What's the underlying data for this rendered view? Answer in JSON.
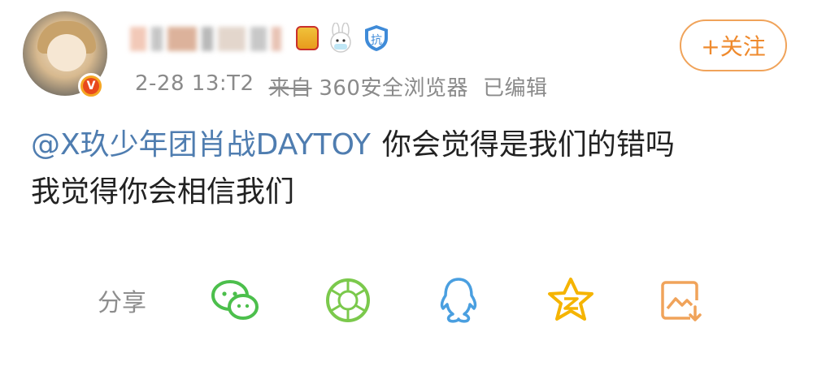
{
  "post": {
    "author_name": "██████",
    "meta": {
      "time": "2-28 13:T2",
      "source_prefix": "来自",
      "source": "360安全浏览器",
      "edited": "已编辑"
    },
    "follow_label": "+关注",
    "mention": "@X玖少年团肖战DAYTOY",
    "text_line1": "你会觉得是我们的错吗",
    "text_line2": "我觉得你会相信我们"
  },
  "share": {
    "label": "分享",
    "icons": [
      "wechat-icon",
      "moments-icon",
      "qq-icon",
      "qzone-icon",
      "save-image-icon"
    ]
  },
  "colors": {
    "follow": "#ef8a2d",
    "mention": "#4f7db0",
    "green": "#4cbf4c",
    "qq": "#4a9fe0",
    "qzone": "#f5b400",
    "meta": "#8a8a8a"
  }
}
